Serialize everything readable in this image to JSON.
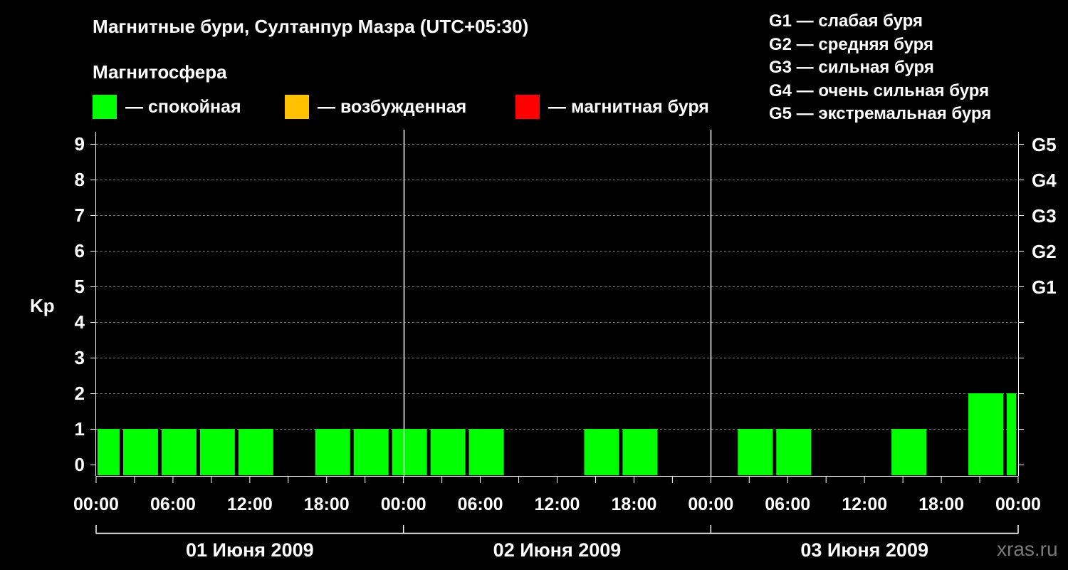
{
  "title": "Магнитные бури, Султанпур Мазра (UTC+05:30)",
  "subtitle": "Магнитосфера",
  "legend": [
    {
      "label": "— спокойная",
      "color": "#00ff00"
    },
    {
      "label": "— возбужденная",
      "color": "#ffc000"
    },
    {
      "label": "— магнитная буря",
      "color": "#ff0000"
    }
  ],
  "g_legend": [
    "G1 — слабая буря",
    "G2 — средняя буря",
    "G3 — сильная буря",
    "G4 — очень сильная буря",
    "G5 — экстремальная буря"
  ],
  "watermark": "xras.ru",
  "chart_data": {
    "type": "bar",
    "ylabel": "Kp",
    "ylim": [
      0,
      9
    ],
    "yticks": [
      "0",
      "1",
      "2",
      "3",
      "4",
      "5",
      "6",
      "7",
      "8",
      "9"
    ],
    "g_ticks": [
      {
        "kp": 5,
        "label": "G1"
      },
      {
        "kp": 6,
        "label": "G2"
      },
      {
        "kp": 7,
        "label": "G3"
      },
      {
        "kp": 8,
        "label": "G4"
      },
      {
        "kp": 9,
        "label": "G5"
      }
    ],
    "grid": true,
    "x_start": "01 Июня 2009 00:00",
    "x_end": "04 Июня 2009 00:00",
    "xtick_labels": [
      "00:00",
      "06:00",
      "12:00",
      "18:00",
      "00:00",
      "06:00",
      "12:00",
      "18:00",
      "00:00",
      "06:00",
      "12:00",
      "18:00",
      "00:00"
    ],
    "days": [
      "01 Июня 2009",
      "02 Июня 2009",
      "03 Июня 2009"
    ],
    "bars": [
      {
        "start": "01 Июня 2009 00:00",
        "end": "01 Июня 2009 02:00",
        "kp": 1
      },
      {
        "start": "01 Июня 2009 02:00",
        "end": "01 Июня 2009 05:00",
        "kp": 1
      },
      {
        "start": "01 Июня 2009 05:00",
        "end": "01 Июня 2009 08:00",
        "kp": 1
      },
      {
        "start": "01 Июня 2009 08:00",
        "end": "01 Июня 2009 11:00",
        "kp": 1
      },
      {
        "start": "01 Июня 2009 11:00",
        "end": "01 Июня 2009 14:00",
        "kp": 1
      },
      {
        "start": "01 Июня 2009 14:00",
        "end": "01 Июня 2009 17:00",
        "kp": 0
      },
      {
        "start": "01 Июня 2009 17:00",
        "end": "01 Июня 2009 20:00",
        "kp": 1
      },
      {
        "start": "01 Июня 2009 20:00",
        "end": "01 Июня 2009 23:00",
        "kp": 1
      },
      {
        "start": "01 Июня 2009 23:00",
        "end": "02 Июня 2009 02:00",
        "kp": 1
      },
      {
        "start": "02 Июня 2009 02:00",
        "end": "02 Июня 2009 05:00",
        "kp": 1
      },
      {
        "start": "02 Июня 2009 05:00",
        "end": "02 Июня 2009 08:00",
        "kp": 1
      },
      {
        "start": "02 Июня 2009 08:00",
        "end": "02 Июня 2009 11:00",
        "kp": 0
      },
      {
        "start": "02 Июня 2009 11:00",
        "end": "02 Июня 2009 14:00",
        "kp": 0
      },
      {
        "start": "02 Июня 2009 14:00",
        "end": "02 Июня 2009 17:00",
        "kp": 1
      },
      {
        "start": "02 Июня 2009 17:00",
        "end": "02 Июня 2009 20:00",
        "kp": 1
      },
      {
        "start": "02 Июня 2009 20:00",
        "end": "02 Июня 2009 23:00",
        "kp": 0
      },
      {
        "start": "02 Июня 2009 23:00",
        "end": "03 Июня 2009 02:00",
        "kp": 0
      },
      {
        "start": "03 Июня 2009 02:00",
        "end": "03 Июня 2009 05:00",
        "kp": 1
      },
      {
        "start": "03 Июня 2009 05:00",
        "end": "03 Июня 2009 08:00",
        "kp": 1
      },
      {
        "start": "03 Июня 2009 08:00",
        "end": "03 Июня 2009 11:00",
        "kp": 0
      },
      {
        "start": "03 Июня 2009 11:00",
        "end": "03 Июня 2009 14:00",
        "kp": 0
      },
      {
        "start": "03 Июня 2009 14:00",
        "end": "03 Июня 2009 17:00",
        "kp": 1
      },
      {
        "start": "03 Июня 2009 17:00",
        "end": "03 Июня 2009 20:00",
        "kp": 0
      },
      {
        "start": "03 Июня 2009 20:00",
        "end": "03 Июня 2009 23:00",
        "kp": 2
      },
      {
        "start": "03 Июня 2009 23:00",
        "end": "04 Июня 2009 00:00",
        "kp": 2
      }
    ]
  }
}
